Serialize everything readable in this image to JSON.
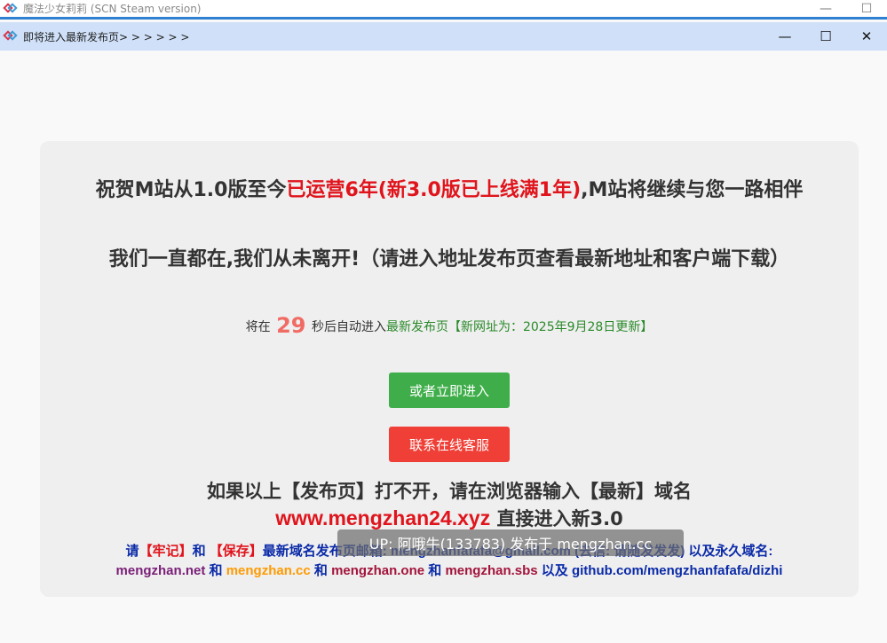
{
  "outer_window": {
    "title": "魔法少女莉莉 (SCN Steam version)",
    "icon": "app-logo-icon",
    "minimize": "—",
    "maximize": "☐"
  },
  "dialog": {
    "title": "即将进入最新发布页> > > > > >",
    "icon": "app-logo-icon",
    "minimize": "—",
    "maximize": "☐",
    "close": "✕"
  },
  "content": {
    "headline1_part1": "祝贺M站从1.0版至今",
    "headline1_red": "已运营6年(新3.0版已上线满1年)",
    "headline1_part2": ",M站将继续与您一路相伴",
    "headline2": "我们一直都在,我们从未离开!（请进入地址发布页查看最新地址和客户端下载）",
    "countdown_prefix": "将在",
    "countdown_seconds": "29",
    "countdown_suffix": "秒后自动进入",
    "countdown_link": "最新发布页【新网址为：2025年9月28日更新】",
    "enter_button": "或者立即进入",
    "support_button": "联系在线客服",
    "fallback_line1": "如果以上【发布页】打不开，请在浏览器输入【最新】域名",
    "fallback_domain": "www.mengzhan24.xyz",
    "fallback_line2_suffix": " 直接进入新3.0",
    "info1_prefix": "请",
    "info1_remember": "【牢记】",
    "info1_and": "和",
    "info1_save": "【保存】",
    "info1_rest": "最新域名发布页邮箱: mengzhanfafafa@gmail.com (去信: 请随发发发) 以及永久域名:",
    "domain_net": "mengzhan.net",
    "and1": " 和 ",
    "domain_cc": "mengzhan.cc",
    "and2": " 和 ",
    "domain_one": "mengzhan.one",
    "and3": " 和 ",
    "domain_sbs": "mengzhan.sbs",
    "also": " 以及 ",
    "domain_github": "github.com/mengzhanfafafa/dizhi"
  },
  "watermark": "UP: 阿哦牛(133783) 发布于 mengzhan.cc",
  "colors": {
    "accent_red": "#e0141c",
    "button_green": "#3fae4a",
    "button_red": "#ef3f36",
    "countdown": "#f06b63",
    "link_blue": "#0a2aa8"
  }
}
